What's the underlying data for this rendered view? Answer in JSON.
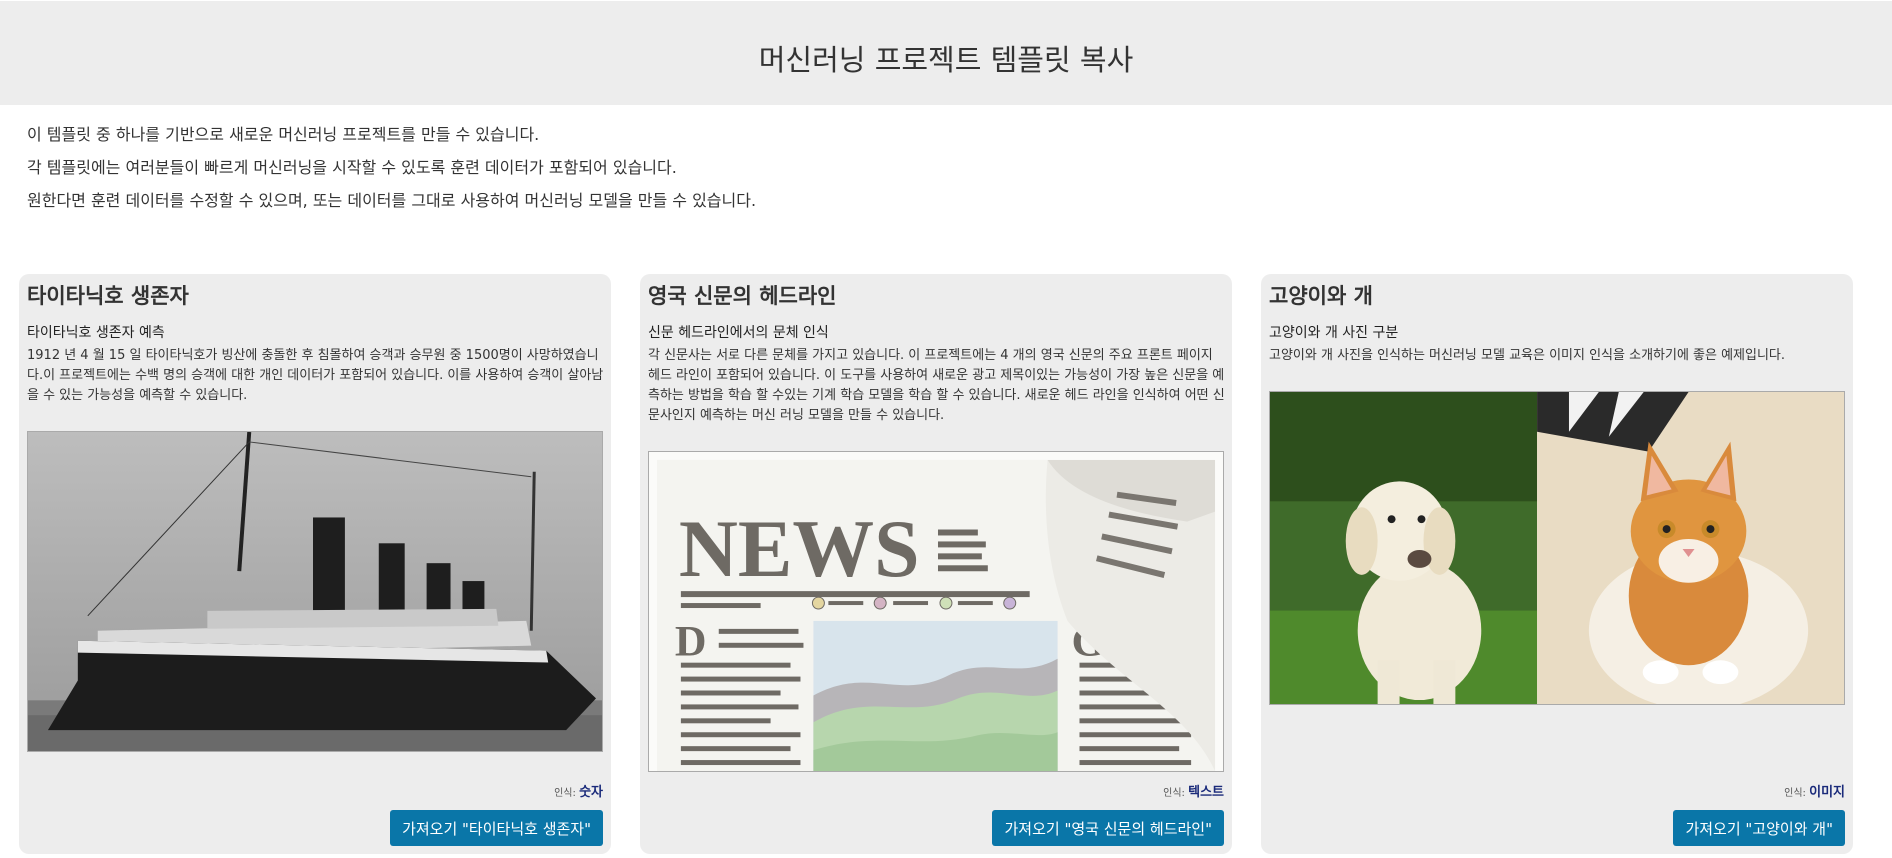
{
  "header": {
    "title": "머신러닝 프로젝트 템플릿 복사"
  },
  "intro": [
    "이 템플릿 중 하나를 기반으로 새로운 머신러닝 프로젝트를 만들 수 있습니다.",
    "각 템플릿에는 여러분들이 빠르게 머신러닝을 시작할 수 있도록 훈련 데이터가 포함되어 있습니다.",
    "원한다면 훈련 데이터를 수정할 수 있으며, 또는 데이터를 그대로 사용하여 머신러닝 모델을 만들 수 있습니다."
  ],
  "cards": [
    {
      "title": "타이타닉호 생존자",
      "subtitle": "타이타닉호 생존자 예측",
      "description": "1912 년 4 월 15 일 타이타닉호가 빙산에 충돌한 후 침몰하여 승객과 승무원 중 1500명이 사망하였습니다.이 프로젝트에는 수백 명의 승객에 대한 개인 데이터가 포함되어 있습니다. 이를 사용하여 승객이 살아남을 수 있는 가능성을 예측할 수 있습니다.",
      "recognition_label": "인식:",
      "recognition_type": "숫자",
      "button": "가져오기 \"타이타닉호 생존자\""
    },
    {
      "title": "영국 신문의 헤드라인",
      "subtitle": "신문 헤드라인에서의 문체 인식",
      "description": "각 신문사는 서로 다른 문체를 가지고 있습니다. 이 프로젝트에는 4 개의 영국 신문의 주요 프론트 페이지 헤드 라인이 포함되어 있습니다. 이 도구를 사용하여 새로운 광고 제목이있는 가능성이 가장 높은 신문을 예측하는 방법을 학습 할 수있는 기계 학습 모델을 학습 할 수 있습니다. 새로운 헤드 라인을 인식하여 어떤 신문사인지 예측하는 머신 러닝 모델을 만들 수 있습니다.",
      "image_text": {
        "news": "NEWS",
        "d": "D",
        "g": "G"
      },
      "recognition_label": "인식:",
      "recognition_type": "텍스트",
      "button": "가져오기 \"영국 신문의 헤드라인\""
    },
    {
      "title": "고양이와 개",
      "subtitle": "고양이와 개 사진 구분",
      "description": "고양이와 개 사진을 인식하는 머신러닝 모델 교육은 이미지 인식을 소개하기에 좋은 예제입니다.",
      "recognition_label": "인식:",
      "recognition_type": "이미지",
      "button": "가져오기 \"고양이와 개\""
    }
  ],
  "colors": {
    "button": "#0a76a8",
    "recognition_type": "#1a2a7a",
    "card_bg": "#ededed"
  }
}
